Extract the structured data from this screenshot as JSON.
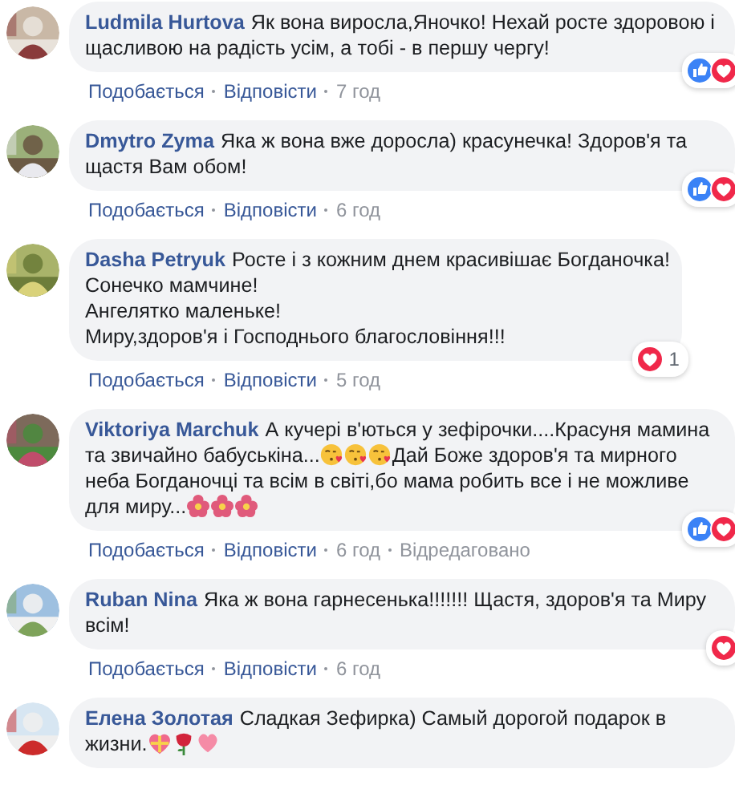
{
  "comments": [
    {
      "author": "Ludmila Hurtova",
      "parts": [
        {
          "kind": "text",
          "text": "Як вона виросла,Яночко! Нехай росте здоровою і щасливою на радість усім, а тобі - в першу чергу!"
        }
      ],
      "reactions": [
        {
          "kind": "like"
        },
        {
          "kind": "love"
        }
      ],
      "actions": [
        "Подобається",
        "Відповісти"
      ],
      "time": "7 год"
    },
    {
      "author": "Dmytro Zyma",
      "parts": [
        {
          "kind": "text",
          "text": "Яка ж вона вже доросла) красунечка! Здоров'я та щастя Вам обом!"
        }
      ],
      "reactions": [
        {
          "kind": "like"
        },
        {
          "kind": "love"
        }
      ],
      "actions": [
        "Подобається",
        "Відповісти"
      ],
      "time": "6 год"
    },
    {
      "author": "Dasha Petryuk",
      "parts": [
        {
          "kind": "text",
          "text": "Росте і з кожним днем красивішає Богданочка!\nСонечко мамчине!\nАнгелятко маленьке!\nМиру,здоров'я і Господнього благословіння!!!"
        }
      ],
      "reactions": [
        {
          "kind": "love"
        }
      ],
      "reaction_count": "1",
      "actions": [
        "Подобається",
        "Відповісти"
      ],
      "time": "5 год"
    },
    {
      "author": "Viktoriya Marchuk",
      "parts": [
        {
          "kind": "text",
          "text": "А кучері в'ються у зефірочки....Красуня мамина та звичайно бабуськіна..."
        },
        {
          "kind": "kiss"
        },
        {
          "kind": "kiss"
        },
        {
          "kind": "kiss"
        },
        {
          "kind": "text",
          "text": "Дай Боже здоров'я та мирного неба Богданочці та всім в світі,бо мама робить все і не можливе для миру..."
        },
        {
          "kind": "flower"
        },
        {
          "kind": "flower"
        },
        {
          "kind": "flower"
        }
      ],
      "reactions": [
        {
          "kind": "like"
        },
        {
          "kind": "love"
        }
      ],
      "actions": [
        "Подобається",
        "Відповісти"
      ],
      "time": "6 год",
      "edited": "Відредаговано"
    },
    {
      "author": "Ruban Nina",
      "parts": [
        {
          "kind": "text",
          "text": "Яка ж вона гарнесенька!!!!!!! Щастя, здоров'я та Миру всім!"
        }
      ],
      "reactions": [
        {
          "kind": "love"
        }
      ],
      "actions": [
        "Подобається",
        "Відповісти"
      ],
      "time": "6 год"
    },
    {
      "author": "Елена Золотая",
      "parts": [
        {
          "kind": "text",
          "text": "Сладкая Зефирка) Самый дорогой подарок в жизни."
        },
        {
          "kind": "gift-heart"
        },
        {
          "kind": "rose"
        },
        {
          "kind": "heart"
        }
      ]
    }
  ]
}
